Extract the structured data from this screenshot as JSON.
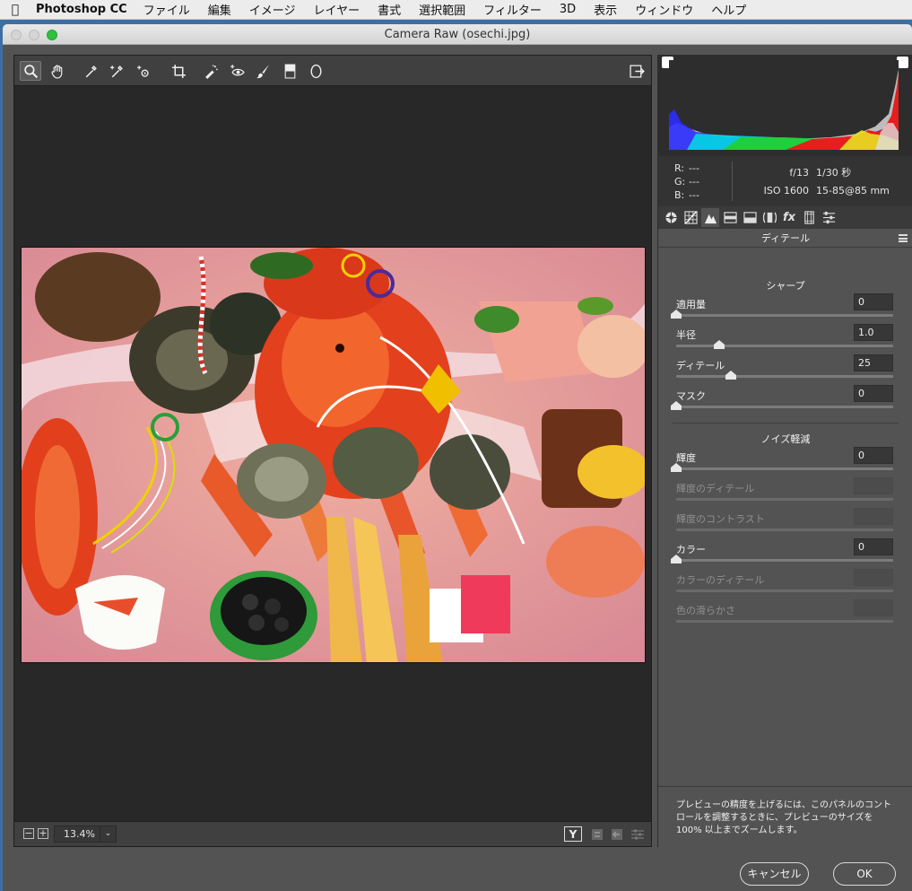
{
  "menubar": {
    "app": "Photoshop CC",
    "items": [
      "ファイル",
      "編集",
      "イメージ",
      "レイヤー",
      "書式",
      "選択範囲",
      "フィルター",
      "3D",
      "表示",
      "ウィンドウ",
      "ヘルプ"
    ]
  },
  "window": {
    "title": "Camera Raw (osechi.jpg)"
  },
  "toolbar": {
    "tools": [
      "zoom-icon",
      "hand-icon",
      "white-balance-icon",
      "color-sampler-icon",
      "targeted-adjustment-icon",
      "crop-icon",
      "spot-removal-icon",
      "red-eye-icon",
      "adjustment-brush-icon",
      "graduated-filter-icon",
      "radial-filter-icon",
      "open-preferences-icon"
    ]
  },
  "statusbar": {
    "zoom": "13.4%"
  },
  "info": {
    "r_label": "R:",
    "r_value": "---",
    "g_label": "G:",
    "g_value": "---",
    "b_label": "B:",
    "b_value": "---",
    "aperture": "f/13",
    "shutter": "1/30 秒",
    "iso": "ISO 1600",
    "lens": "15-85@85 mm"
  },
  "panel": {
    "title": "ディテール",
    "sharpen": {
      "title": "シャープ",
      "amount": {
        "label": "適用量",
        "value": "0",
        "pos": 0
      },
      "radius": {
        "label": "半径",
        "value": "1.0",
        "pos": 0.2
      },
      "detail": {
        "label": "ディテール",
        "value": "25",
        "pos": 0.25
      },
      "masking": {
        "label": "マスク",
        "value": "0",
        "pos": 0
      }
    },
    "noise": {
      "title": "ノイズ軽減",
      "luminance": {
        "label": "輝度",
        "value": "0",
        "pos": 0
      },
      "lum_detail": {
        "label": "輝度のディテール",
        "value": ""
      },
      "lum_contrast": {
        "label": "輝度のコントラスト",
        "value": ""
      },
      "color": {
        "label": "カラー",
        "value": "0",
        "pos": 0
      },
      "color_detail": {
        "label": "カラーのディテール",
        "value": ""
      },
      "color_smooth": {
        "label": "色の滑らかさ",
        "value": ""
      }
    },
    "note": "プレビューの精度を上げるには、このパネルのコントロールを調整するときに、プレビューのサイズを 100% 以上までズームします。"
  },
  "buttons": {
    "cancel": "キャンセル",
    "ok": "OK"
  }
}
